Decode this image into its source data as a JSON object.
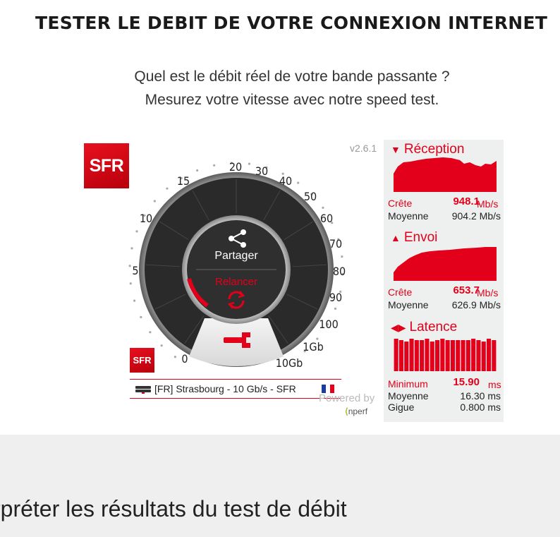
{
  "header": {
    "title": "TESTER LE DEBIT DE VOTRE CONNEXION INTERNET",
    "subtitle_line1": "Quel est le débit réel de votre bande passante ?",
    "subtitle_line2": "Mesurez votre vitesse avec notre speed test."
  },
  "speedtest": {
    "logo_text": "SFR",
    "logo_small_text": "SFR",
    "version": "v2.6.1",
    "share_label": "Partager",
    "restart_label": "Relancer",
    "scale_labels": [
      "0",
      "5",
      "10",
      "15",
      "20",
      "30",
      "40",
      "50",
      "60",
      "70",
      "80",
      "90",
      "100",
      "1Gb",
      "10Gb"
    ],
    "server": "[FR] Strasbourg - 10 Gb/s - SFR",
    "powered_by": "Powered by",
    "nperf_logo": "nperf",
    "colors": {
      "accent": "#e2001a",
      "dial": "#2a2a2a",
      "panel": "#eef0f0"
    }
  },
  "stats": {
    "reception": {
      "title": "Réception",
      "peak_label": "Crête",
      "peak_value": "948.1",
      "peak_unit": "Mb/s",
      "avg_label": "Moyenne",
      "avg_value": "904.2 Mb/s"
    },
    "upload": {
      "title": "Envoi",
      "peak_label": "Crête",
      "peak_value": "653.7",
      "peak_unit": "Mb/s",
      "avg_label": "Moyenne",
      "avg_value": "626.9 Mb/s"
    },
    "latency": {
      "title": "Latence",
      "min_label": "Minimum",
      "min_value": "15.90",
      "min_unit": "ms",
      "avg_label": "Moyenne",
      "avg_value": "16.30 ms",
      "jitter_label": "Gigue",
      "jitter_value": "0.800 ms"
    }
  },
  "footer": {
    "heading_partial": "rpréter les résultats du test de débit"
  }
}
